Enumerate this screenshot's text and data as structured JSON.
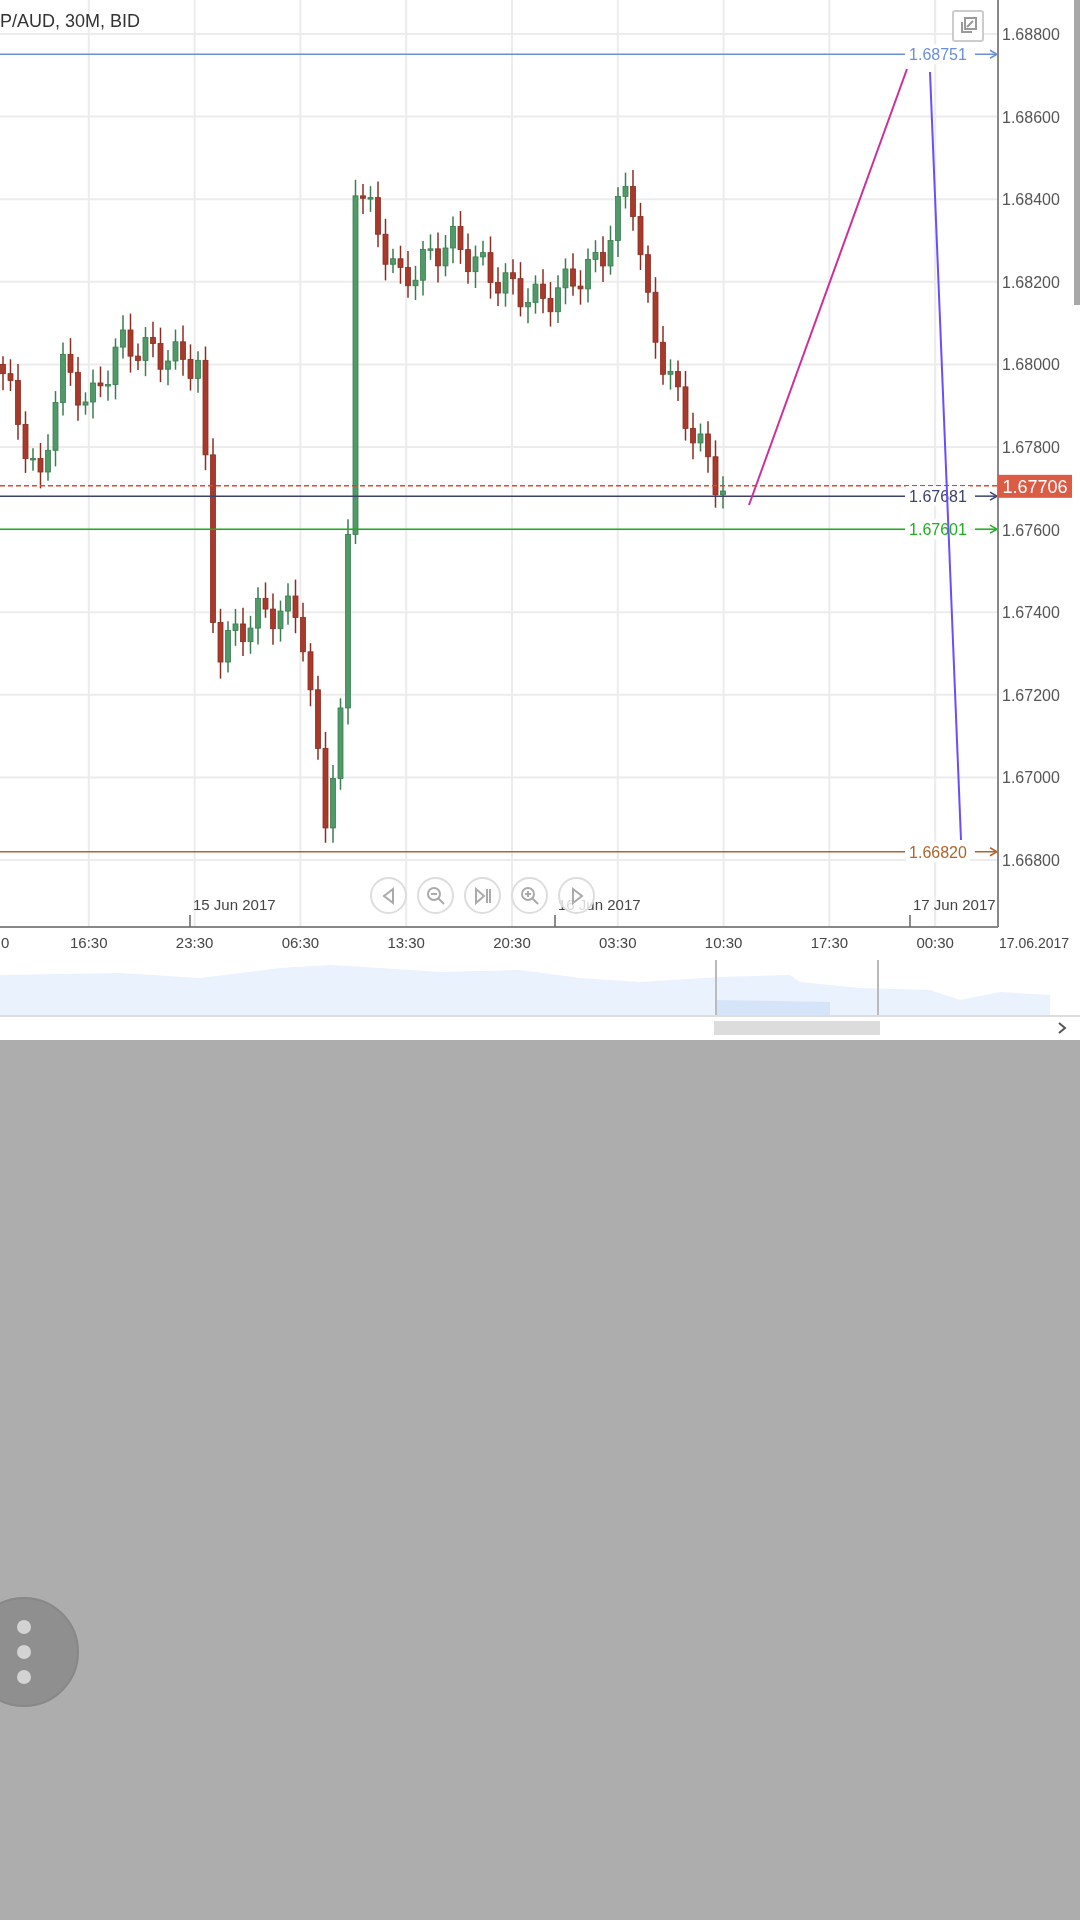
{
  "chart": {
    "title": "P/AUD, 30M, BID",
    "y_ticks": [
      "1.68800",
      "1.68600",
      "1.68400",
      "1.68200",
      "1.68000",
      "1.67800",
      "1.67600",
      "1.67400",
      "1.67200",
      "1.67000",
      "1.66800"
    ],
    "time_labels": [
      "0",
      "16:30",
      "23:30",
      "06:30",
      "13:30",
      "20:30",
      "03:30",
      "10:30",
      "17:30",
      "00:30"
    ],
    "date_labels": [
      "15 Jun 2017",
      "16 Jun 2017",
      "17 Jun 2017"
    ],
    "axis_date": "17.06.2017",
    "price_lines": [
      {
        "label": "1.68751",
        "color": "#6b8fd8"
      },
      {
        "label": "1.67681",
        "color": "#3c4170"
      },
      {
        "label": "1.67601",
        "color": "#1fae1f"
      },
      {
        "label": "1.66820",
        "color": "#b0642c"
      }
    ],
    "current_price": "1.67706"
  }
}
